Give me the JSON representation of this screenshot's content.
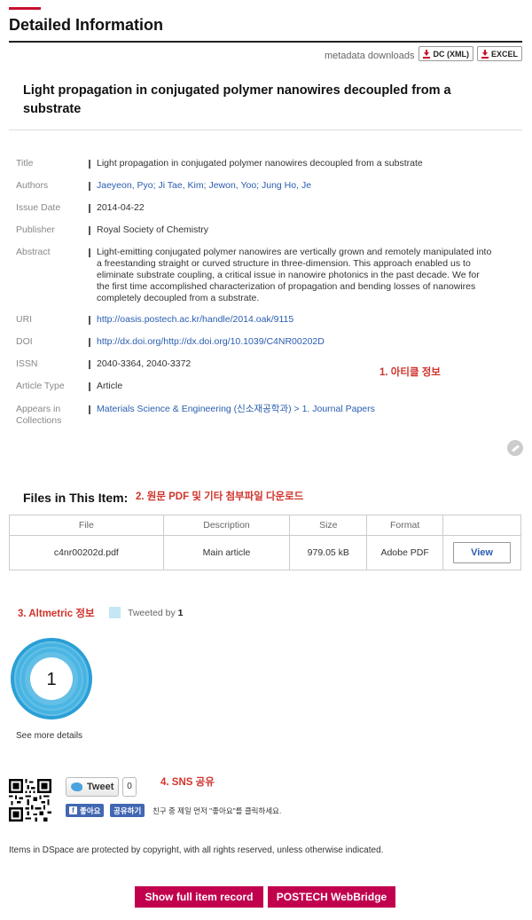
{
  "header": {
    "title": "Detailed Information"
  },
  "metadata_downloads": {
    "label": "metadata downloads",
    "dc_label": "DC (XML)",
    "excel_label": "EXCEL"
  },
  "item_title": "Light propagation in conjugated polymer nanowires decoupled from a substrate",
  "fields": [
    {
      "label": "Title",
      "value": "Light propagation in conjugated polymer nanowires decoupled from a substrate",
      "link": false
    },
    {
      "label": "Authors",
      "value": "Jaeyeon, Pyo; Ji Tae, Kim; Jewon, Yoo; Jung Ho, Je",
      "link": true
    },
    {
      "label": "Issue Date",
      "value": "2014-04-22",
      "link": false
    },
    {
      "label": "Publisher",
      "value": "Royal Society of Chemistry",
      "link": false
    },
    {
      "label": "Abstract",
      "value": "Light-emitting conjugated polymer nanowires are vertically grown and remotely manipulated into a freestanding straight or curved structure in three-dimension. This approach enabled us to eliminate substrate coupling, a critical issue in nanowire photonics in the past decade. We for the first time accomplished characterization of propagation and bending losses of nanowires completely decoupled from a substrate.",
      "link": false
    },
    {
      "label": "URI",
      "value": "http://oasis.postech.ac.kr/handle/2014.oak/9115",
      "link": true
    },
    {
      "label": "DOI",
      "value": "http://dx.doi.org/http://dx.doi.org/10.1039/C4NR00202D",
      "link": true
    },
    {
      "label": "ISSN",
      "value": "2040-3364, 2040-3372",
      "link": false
    },
    {
      "label": "Article Type",
      "value": "Article",
      "link": false
    },
    {
      "label": "Appears in",
      "label2": "Collections",
      "value": "Materials Science & Engineering (신소재공학과) > 1. Journal Papers",
      "link": true
    }
  ],
  "annotations": {
    "article": "1. 아티클 정보",
    "files": "2. 원문 PDF 및 기타 첨부파일 다운로드",
    "altmetric": "3. Altmetric 정보",
    "sns": "4. SNS 공유"
  },
  "files": {
    "title": "Files in This Item:",
    "columns": [
      "File",
      "Description",
      "Size",
      "Format",
      ""
    ],
    "rows": [
      {
        "file": "c4nr00202d.pdf",
        "description": "Main article",
        "size": "979.05 kB",
        "format": "Adobe PDF",
        "action": "View"
      }
    ]
  },
  "altmetric": {
    "legend_label": "Tweeted by",
    "legend_count": "1",
    "score": "1",
    "see_more": "See more details",
    "color": "#2a9fd6"
  },
  "sns": {
    "tweet_label": "Tweet",
    "tweet_count": "0",
    "fb_like": "좋아요",
    "fb_share": "공유하기",
    "fb_text": "친구 중 제일 먼저 \"좋아요\"를 클릭하세요."
  },
  "footer": {
    "copyright": "Items in DSpace are protected by copyright, with all rights reserved, unless otherwise indicated.",
    "full_record_label": "Show full item record",
    "webbridge_label": "POSTECH WebBridge"
  }
}
